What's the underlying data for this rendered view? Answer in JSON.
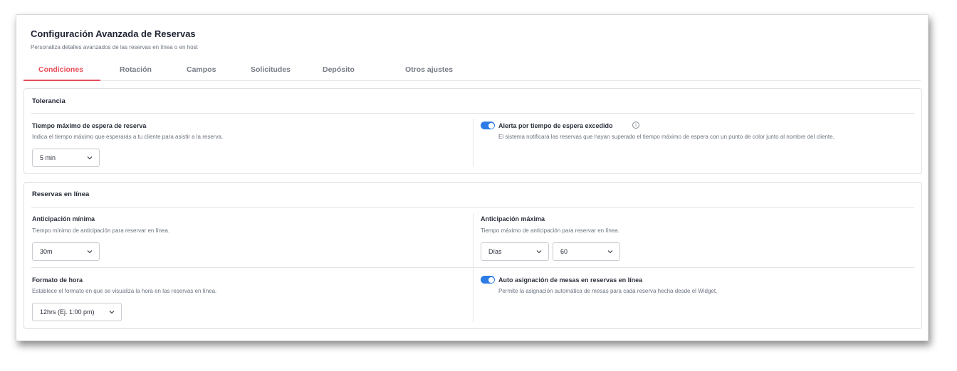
{
  "header": {
    "title": "Configuración Avanzada de Reservas",
    "subtitle": "Personaliza detalles avanzados de las reservas en línea o en host"
  },
  "tabs": [
    {
      "label": "Condiciones",
      "active": true
    },
    {
      "label": "Rotación",
      "active": false
    },
    {
      "label": "Campos",
      "active": false
    },
    {
      "label": "Solicitudes",
      "active": false
    },
    {
      "label": "Depósito",
      "active": false
    },
    {
      "label": "Otros ajustes",
      "active": false
    }
  ],
  "tolerancia": {
    "title": "Tolerancia",
    "max_wait": {
      "label": "Tiempo máximo de espera de reserva",
      "description": "Indica el tiempo máximo que esperarás a tu cliente para asistir a la reserva.",
      "value": "5 min"
    },
    "alert": {
      "label": "Alerta por tiempo de espera excedido",
      "description": "El sistema notificará las reservas que hayan superado el tiempo máximo de espera con un punto de color junto al nombre del cliente.",
      "enabled": true,
      "info_icon": "info-icon"
    }
  },
  "reservas_online": {
    "title": "Reservas en línea",
    "min_advance": {
      "label": "Anticipación mínima",
      "description": "Tiempo mínimo de anticipación para reservar en línea.",
      "value": "30m"
    },
    "max_advance": {
      "label": "Anticipación máxima",
      "description": "Tiempo máximo de anticipación para reservar en línea.",
      "unit_value": "Días",
      "amount_value": "60"
    },
    "time_format": {
      "label": "Formato de hora",
      "description": "Establece el formato en que se visualiza la hora en las reservas en línea.",
      "value": "12hrs (Ej. 1:00 pm)"
    },
    "auto_assign": {
      "label": "Auto asignación de mesas en reservas en línea",
      "description": "Permite la asignación automática de mesas para cada reserva hecha desde el Widget.",
      "enabled": true
    }
  },
  "colors": {
    "accent": "#e74c5a",
    "toggle_on": "#2d7be5"
  }
}
